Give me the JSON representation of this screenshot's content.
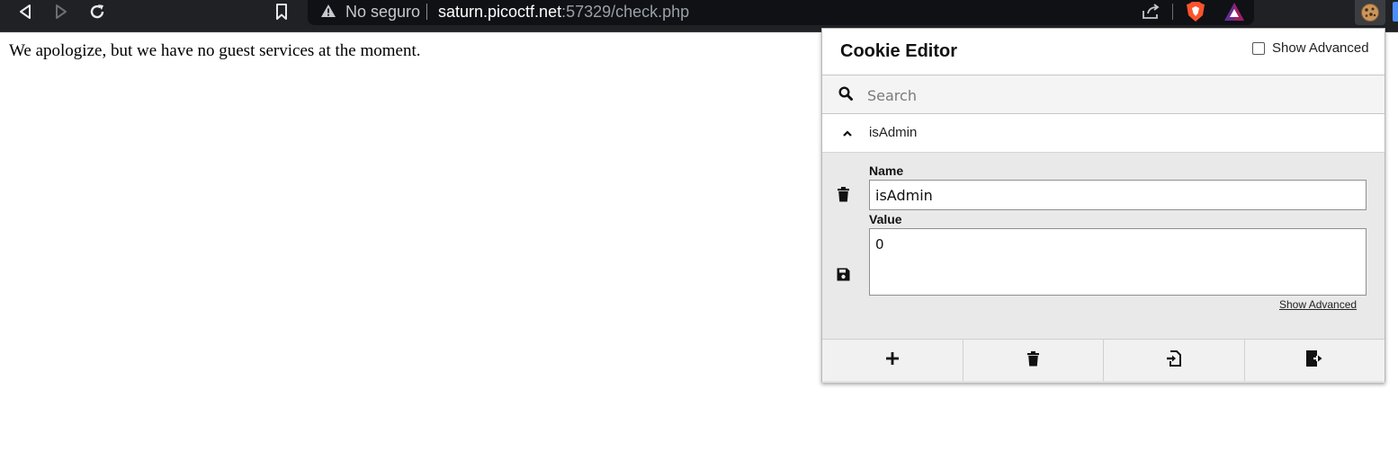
{
  "browser": {
    "security_label": "No seguro",
    "url_host": "saturn.picoctf.net",
    "url_rest": ":57329/check.php",
    "icons": [
      "back-icon",
      "forward-icon",
      "reload-icon",
      "bookmark-icon",
      "warning-icon",
      "share-icon",
      "brave-shields-icon",
      "brave-rewards-icon",
      "cookie-editor-extension-icon"
    ]
  },
  "page": {
    "message": "We apologize, but we have no guest services at the moment."
  },
  "cookie_editor": {
    "title": "Cookie Editor",
    "show_advanced_top": "Show Advanced",
    "show_advanced_checked": false,
    "search_placeholder": "Search",
    "cookie": {
      "name_header": "isAdmin",
      "name_label": "Name",
      "name_value": "isAdmin",
      "value_label": "Value",
      "value_value": "0",
      "show_advanced_link": "Show Advanced"
    },
    "actions": [
      "add-icon",
      "delete-all-icon",
      "import-icon",
      "export-icon"
    ]
  },
  "colors": {
    "toolbar": "#202124",
    "omnibox": "#0f1115",
    "url_host": "#ffffff",
    "url_rest": "#9aa0a6",
    "brave_orange": "#fb542b",
    "panel_gray": "#e9e9e9"
  }
}
